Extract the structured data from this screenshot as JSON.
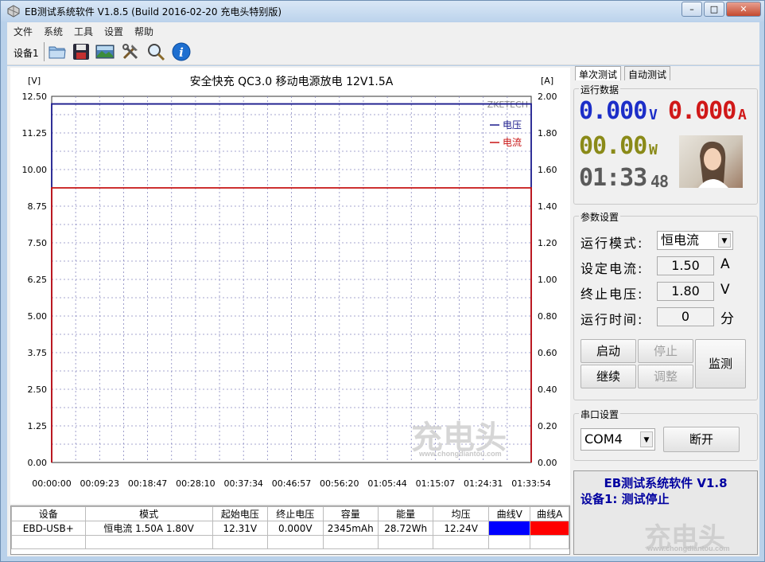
{
  "window": {
    "title": "EB测试系统软件 V1.8.5 (Build 2016-02-20 充电头特别版)"
  },
  "menu": [
    "文件",
    "系统",
    "工具",
    "设置",
    "帮助"
  ],
  "toolbar": {
    "device_label": "设备1",
    "icons": [
      "folder-icon",
      "save-icon",
      "image-icon",
      "tools-icon",
      "search-icon",
      "info-icon"
    ]
  },
  "chart_data": {
    "type": "line",
    "title": "安全快充 QC3.0 移动电源放电 12V1.5A",
    "watermark": "ZKETECH",
    "y_left_unit": "[V]",
    "y_right_unit": "[A]",
    "y_left_ticks": [
      "12.50",
      "11.25",
      "10.00",
      "8.75",
      "7.50",
      "6.25",
      "5.00",
      "3.75",
      "2.50",
      "1.25",
      "0.00"
    ],
    "y_right_ticks": [
      "2.00",
      "1.80",
      "1.60",
      "1.40",
      "1.20",
      "1.00",
      "0.80",
      "0.60",
      "0.40",
      "0.20",
      "0.00"
    ],
    "x_ticks": [
      "00:00:00",
      "00:09:23",
      "00:18:47",
      "00:28:10",
      "00:37:34",
      "00:46:57",
      "00:56:20",
      "01:05:44",
      "01:15:07",
      "01:24:31",
      "01:33:54"
    ],
    "ylim_left": [
      0,
      12.5
    ],
    "ylim_right": [
      0,
      2.0
    ],
    "legend": "top-right",
    "series": [
      {
        "name": "电压",
        "color": "#1a1a8c",
        "axis": "left",
        "x_start": "00:00:00",
        "x_end": "01:33:54",
        "value": 12.24
      },
      {
        "name": "电流",
        "color": "#c81414",
        "axis": "right",
        "x_start": "00:00:00",
        "x_end": "01:33:54",
        "value": 1.5
      }
    ]
  },
  "table": {
    "headers": [
      "设备",
      "模式",
      "起始电压",
      "终止电压",
      "容量",
      "能量",
      "均压",
      "曲线V",
      "曲线A"
    ],
    "rows": [
      [
        "EBD-USB+",
        "恒电流  1.50A  1.80V",
        "12.31V",
        "0.000V",
        "2345mAh",
        "28.72Wh",
        "12.24V",
        "",
        ""
      ]
    ],
    "curve_v_color": "#0000ff",
    "curve_a_color": "#ff0000"
  },
  "tabs": [
    "单次测试",
    "自动测试"
  ],
  "run_data": {
    "label": "运行数据",
    "voltage": "0.000",
    "voltage_unit": "V",
    "current": "0.000",
    "current_unit": "A",
    "power": "00.00",
    "power_unit": "W",
    "time_main": "01:33",
    "time_sec": "48",
    "colors": {
      "voltage": "#1c2ec8",
      "current": "#d01818",
      "power": "#8a8a18",
      "time": "#5a5a5a"
    }
  },
  "params": {
    "label": "参数设置",
    "mode_label": "运行模式:",
    "mode_value": "恒电流",
    "current_label": "设定电流:",
    "current_value": "1.50",
    "current_unit": "A",
    "stop_voltage_label": "终止电压:",
    "stop_voltage_value": "1.80",
    "stop_voltage_unit": "V",
    "run_time_label": "运行时间:",
    "run_time_value": "0",
    "run_time_unit": "分",
    "buttons": {
      "start": "启动",
      "stop": "停止",
      "continue": "继续",
      "adjust": "调整",
      "monitor": "监测"
    }
  },
  "serial": {
    "label": "串口设置",
    "port": "COM4",
    "disconnect": "断开"
  },
  "status": {
    "line1": "EB测试系统软件 V1.8",
    "line2": "设备1: 测试停止"
  },
  "watermarks": {
    "brand": "充电头",
    "url": "www.chongdiantou.com"
  }
}
